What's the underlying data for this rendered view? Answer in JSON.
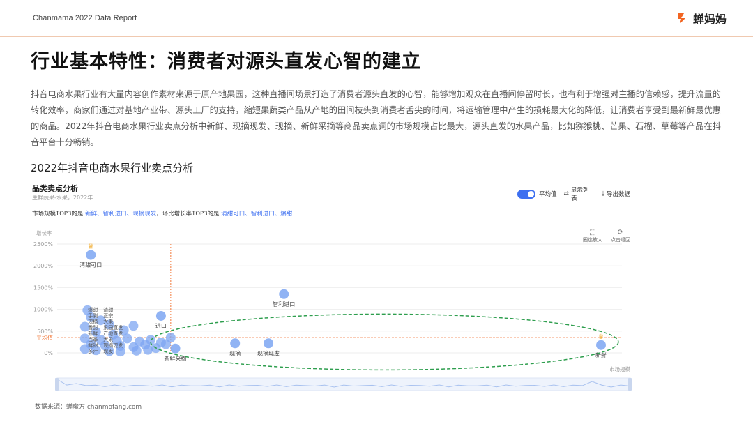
{
  "header": {
    "report_label": "Chanmama 2022 Data Report",
    "brand_name": "蝉妈妈",
    "brand_color": "#f26522"
  },
  "title": "行业基本特性：消费者对源头直发心智的建立",
  "paragraph": "抖音电商水果行业有大量内容创作素材来源于原产地果园，这种直播间场景打造了消费者源头直发的心智，能够增加观众在直播间停留时长，也有利于增强对主播的信赖感，提升流量的转化效率，商家们通过对基地产业带、源头工厂的支持，缩短果蔬类产品从产地的田间枝头到消费者舌尖的时间，将运输管理中产生的损耗最大化的降低，让消费者享受到最新鲜最优惠的商品。2022年抖音电商水果行业卖点分析中新鲜、现摘现发、现摘、新鲜采摘等商品卖点词的市场规模占比最大，源头直发的水果产品，比如猕猴桃、芒果、石榴、草莓等产品在抖音平台十分畅销。",
  "section_title": "2022年抖音电商水果行业卖点分析",
  "panel": {
    "title": "品类卖点分析",
    "meta": "生鲜蔬果-水果，2022年",
    "desc_prefix": "市场规模TOP3的是 ",
    "desc_top_scale": "新鲜、智利进口、现摘现发",
    "desc_mid": "，环比增长率TOP3的是 ",
    "desc_top_growth": "清甜可口、智利进口、爆甜",
    "toggle_label": "平均值",
    "show_list_label": "显示列表",
    "export_label": "导出数据",
    "zoom_label": "圈选放大",
    "reset_label": "点击退回",
    "ylabel": "增长率",
    "xlabel": "市场规模",
    "avg_label": "平均值",
    "source": "数据来源：蝉魔方 chanmofang.com",
    "watermark": "蝉魔方"
  },
  "colors": {
    "point": "#7da6f2",
    "avg_line": "#f27a3c",
    "ellipse": "#2e9e4e",
    "link": "#3d6ff0"
  },
  "chart_data": {
    "type": "scatter",
    "xlabel": "市场规模",
    "ylabel": "增长率",
    "y_ticks": [
      "0%",
      "500%",
      "1000%",
      "1500%",
      "2000%",
      "2500%"
    ],
    "ylim": [
      0,
      2500
    ],
    "x_unit": "relative market scale (unlabeled)",
    "average_growth": 350,
    "labeled_points": [
      {
        "label": "清甜可口",
        "x": 1.5,
        "y": 2250,
        "crown": true
      },
      {
        "label": "智利进口",
        "x": 45,
        "y": 1350
      },
      {
        "label": "进口",
        "x": 12,
        "y": 850
      },
      {
        "label": "现摘",
        "x": 30,
        "y": 220
      },
      {
        "label": "现摘现发",
        "x": 40,
        "y": 220
      },
      {
        "label": "新鲜采摘",
        "x": 15,
        "y": 100
      },
      {
        "label": "新鲜",
        "x": 190,
        "y": 180,
        "crown": true
      }
    ],
    "unlabeled_points": [
      {
        "x": 1.2,
        "y": 980
      },
      {
        "x": 1.5,
        "y": 820
      },
      {
        "x": 2.5,
        "y": 750
      },
      {
        "x": 3.5,
        "y": 650
      },
      {
        "x": 1.0,
        "y": 600
      },
      {
        "x": 2.0,
        "y": 480
      },
      {
        "x": 4.0,
        "y": 420
      },
      {
        "x": 5.5,
        "y": 520
      },
      {
        "x": 7.0,
        "y": 620
      },
      {
        "x": 1.0,
        "y": 330
      },
      {
        "x": 2.5,
        "y": 300
      },
      {
        "x": 4.5,
        "y": 280
      },
      {
        "x": 6.0,
        "y": 330
      },
      {
        "x": 8.0,
        "y": 260
      },
      {
        "x": 10.0,
        "y": 300
      },
      {
        "x": 12.0,
        "y": 240
      },
      {
        "x": 1.5,
        "y": 200
      },
      {
        "x": 3.0,
        "y": 170
      },
      {
        "x": 5.0,
        "y": 160
      },
      {
        "x": 7.0,
        "y": 130
      },
      {
        "x": 9.0,
        "y": 190
      },
      {
        "x": 1.0,
        "y": 90
      },
      {
        "x": 2.0,
        "y": 60
      },
      {
        "x": 3.5,
        "y": 40
      },
      {
        "x": 5.0,
        "y": 30
      },
      {
        "x": 7.5,
        "y": 50
      },
      {
        "x": 9.5,
        "y": 70
      },
      {
        "x": 11.0,
        "y": 110
      },
      {
        "x": 13.0,
        "y": 200
      },
      {
        "x": 14.0,
        "y": 350
      }
    ],
    "crowded_labels": [
      "爆甜",
      "清甜",
      "手剥",
      "正宗",
      "现摘",
      "大果",
      "香甜",
      "果园直发",
      "新鲜",
      "产地直发",
      "当季",
      "大果",
      "鲜甜",
      "现摘现发",
      "多汁",
      "现发"
    ]
  }
}
